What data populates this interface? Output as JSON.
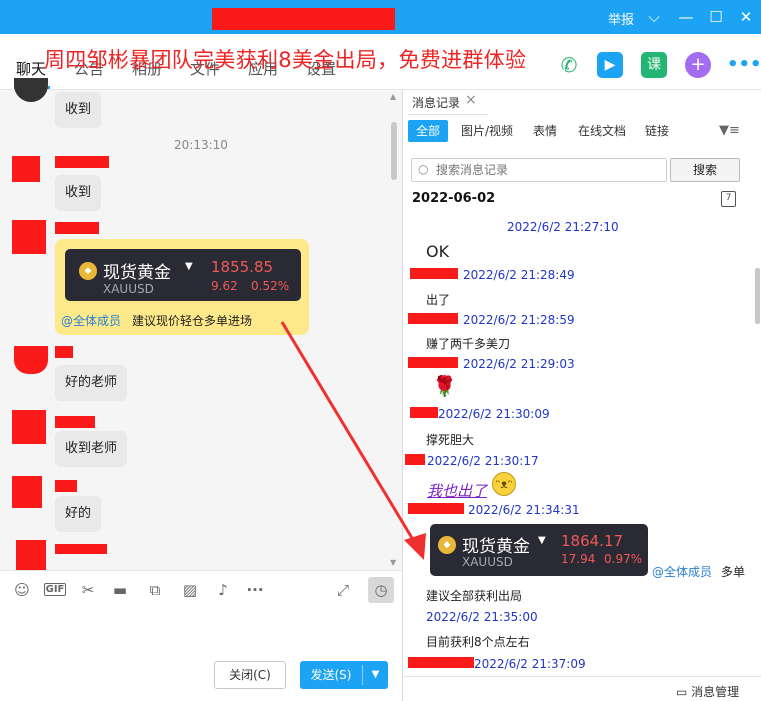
{
  "titlebar": {
    "report_label": "举报",
    "chevron_icon": "chevron-down-icon",
    "minimize_icon": "minimize-icon",
    "maximize_icon": "maximize-icon",
    "close_icon": "close-icon"
  },
  "tabs": {
    "items": [
      "聊天",
      "公告",
      "相册",
      "文件",
      "应用",
      "设置"
    ],
    "active": "聊天"
  },
  "banner_text": "周四邹彬暴团队完美获利8美金出局，免费进群体验",
  "toolbar_icons": [
    "phone-icon",
    "video-icon",
    "course-icon",
    "add-app-icon",
    "more-icon"
  ],
  "toolbar_course_label": "课",
  "chat": {
    "time_divider": "20:13:10",
    "messages": [
      "收到",
      "收到",
      "好的老师",
      "收到老师",
      "好的"
    ],
    "gold_card": {
      "name": "现货黄金",
      "code": "XAUUSD",
      "price": "1855.85",
      "change": "9.62",
      "change_pct": "0.52%"
    },
    "mention": "@全体成员",
    "advice": "建议现价轻仓多单进场"
  },
  "input_toolbar_icons": [
    "emoji-icon",
    "gif-icon",
    "scissors-icon",
    "folder-icon",
    "shake-icon",
    "image-icon",
    "bell-icon",
    "more-icon",
    "expand-icon",
    "history-icon"
  ],
  "buttons": {
    "close": "关闭(C)",
    "send": "发送(S)"
  },
  "right_panel": {
    "tab_title": "消息记录",
    "filters": [
      "全部",
      "图片/视频",
      "表情",
      "在线文档",
      "链接"
    ],
    "search_placeholder": "搜索消息记录",
    "search_button": "搜索",
    "date_header": "2022-06-02",
    "calendar_label": "7",
    "records": [
      {
        "time": "2022/6/2 21:27:10",
        "text": "OK"
      },
      {
        "time": "2022/6/2 21:28:49",
        "text": "出了"
      },
      {
        "time": "2022/6/2 21:28:59",
        "text": "赚了两千多美刀"
      },
      {
        "time": "2022/6/2 21:29:03",
        "text": ""
      },
      {
        "time": "2022/6/2 21:30:09",
        "text": "撑死胆大"
      },
      {
        "time": "2022/6/2 21:30:17",
        "text": "我也出了"
      },
      {
        "time": "2022/6/2 21:34:31",
        "text": ""
      },
      {
        "time": "2022/6/2 21:35:00",
        "text": "目前获利8个点左右"
      },
      {
        "time": "2022/6/2 21:37:09",
        "text": ""
      }
    ],
    "gold_card": {
      "name": "现货黄金",
      "code": "XAUUSD",
      "price": "1864.17",
      "change": "17.94",
      "change_pct": "0.97%"
    },
    "mention": "@全体成员",
    "mention_tail": "多单",
    "advice_line": "建议全部获利出局",
    "footer": "消息管理"
  },
  "colors": {
    "accent": "#1ca3f3",
    "redaction": "#fb1a1a",
    "banner": "#ef2424",
    "timestamp": "#2036c8"
  }
}
